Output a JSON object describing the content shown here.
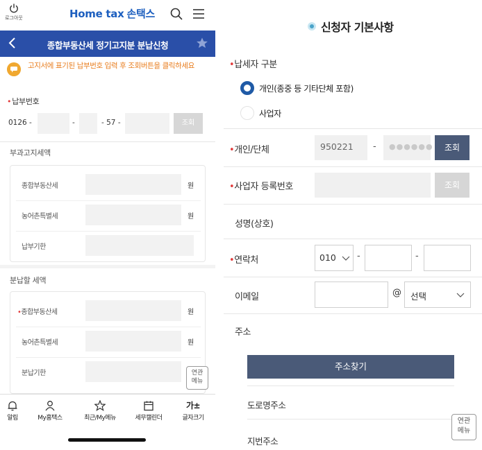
{
  "left": {
    "logout_label": "로그아웃",
    "brand_name": "Home tax",
    "brand_kr": "손택스",
    "title": "종합부동산세 정기고지분 분납신청",
    "notice": "고지서에 표기된 납부번호 입력 후 조회버튼을 클릭하세요",
    "payment_number": {
      "label": "납부번호",
      "prefix": "0126 -",
      "mid_dash": "-",
      "mid_value": "- 57 -",
      "button": "조회"
    },
    "assessed": {
      "section_title": "부과고지세액",
      "rows": [
        {
          "label": "종합부동산세",
          "unit": "원"
        },
        {
          "label": "농어촌특별세",
          "unit": "원"
        },
        {
          "label": "납부기한",
          "unit": ""
        }
      ]
    },
    "installment": {
      "section_title": "분납할 세액",
      "rows": [
        {
          "label": "종합부동산세",
          "unit": "원",
          "required": true
        },
        {
          "label": "농어촌특별세",
          "unit": "원",
          "required": false
        },
        {
          "label": "분납기한",
          "unit": "",
          "required": false
        }
      ]
    },
    "related_menu": "연관\n메뉴",
    "bottom_nav": [
      {
        "label": "알림",
        "icon": "bell-icon"
      },
      {
        "label": "My홈택스",
        "icon": "person-icon"
      },
      {
        "label": "최근/My메뉴",
        "icon": "star-icon"
      },
      {
        "label": "세무캘린더",
        "icon": "calendar-icon"
      },
      {
        "label": "글자크기",
        "icon": "font-size-icon"
      }
    ],
    "bottom_nav_font_glyph": "가±"
  },
  "right": {
    "title": "신청자 기본사항",
    "taxpayer_type_label": "납세자 구분",
    "radio_options": [
      {
        "label": "개인(종중 등 기타단체 포함)",
        "selected": true
      },
      {
        "label": "사업자",
        "selected": false
      }
    ],
    "individual": {
      "label": "개인/단체",
      "value": "950221",
      "dash": "-",
      "masked": "●●●●●●",
      "button": "조회"
    },
    "business": {
      "label": "사업자 등록번호",
      "button": "조회"
    },
    "name_label": "성명(상호)",
    "contact": {
      "label": "연락처",
      "prefix": "010",
      "dash1": "-",
      "dash2": "-"
    },
    "email": {
      "label": "이메일",
      "at": "@",
      "select": "선택"
    },
    "address": {
      "label": "주소",
      "find_button": "주소찾기",
      "road_label": "도로명주소",
      "lot_label": "지번주소"
    },
    "related_menu": "연관\n메뉴"
  },
  "colors": {
    "titlebar": "#2a4fa8",
    "brand": "#1d5fbf",
    "notice": "#e87d1e",
    "required": "#e23b3b",
    "dark_button": "#4a5a78",
    "radio_on": "#1f5aa6"
  }
}
